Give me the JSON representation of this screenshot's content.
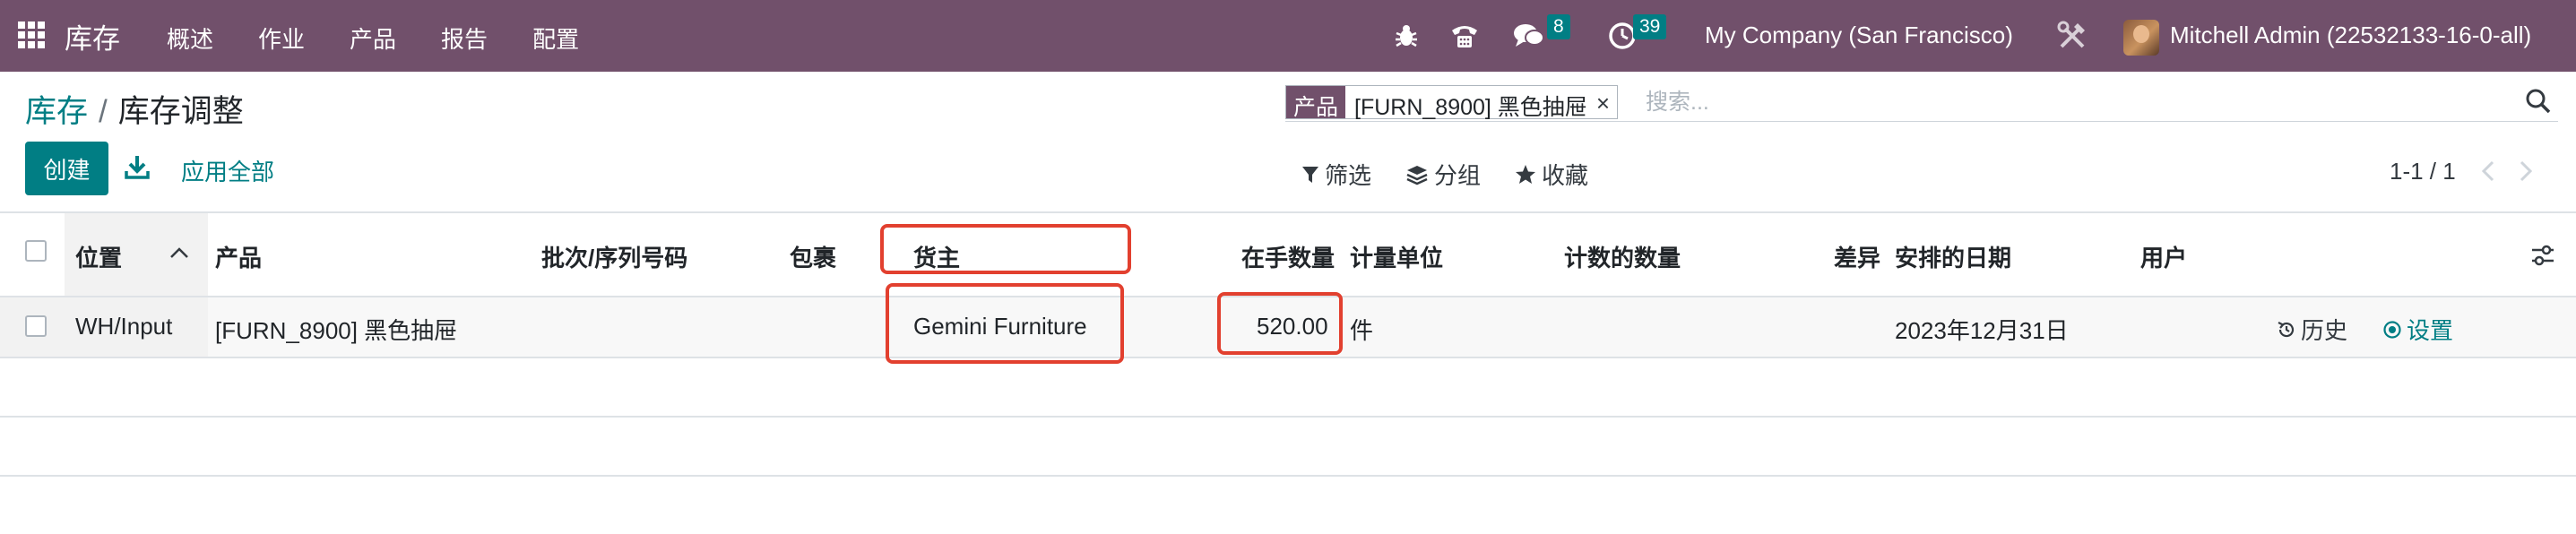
{
  "navbar": {
    "app_name": "库存",
    "menu": [
      "概述",
      "作业",
      "产品",
      "报告",
      "配置"
    ],
    "messages_count": "8",
    "activities_count": "39",
    "company": "My Company (San Francisco)",
    "user": "Mitchell Admin (22532133-16-0-all)"
  },
  "breadcrumb": {
    "parent": "库存",
    "separator": "/",
    "current": "库存调整"
  },
  "search": {
    "facet_label": "产品",
    "facet_value": "[FURN_8900] 黑色抽屉",
    "facet_close": "×",
    "placeholder": "搜索..."
  },
  "actions": {
    "create": "创建",
    "apply_all": "应用全部"
  },
  "search_options": {
    "filters": "筛选",
    "group_by": "分组",
    "favorites": "收藏"
  },
  "pager": {
    "range": "1-1 / 1"
  },
  "table": {
    "columns": {
      "location": "位置",
      "product": "产品",
      "lot": "批次/序列号码",
      "package": "包裹",
      "owner": "货主",
      "on_hand": "在手数量",
      "uom": "计量单位",
      "counted": "计数的数量",
      "difference": "差异",
      "scheduled_date": "安排的日期",
      "user": "用户"
    },
    "rows": [
      {
        "location": "WH/Input",
        "product": "[FURN_8900] 黑色抽屉",
        "owner": "Gemini Furniture",
        "on_hand": "520.00",
        "uom": "件",
        "scheduled_date": "2023年12月31日",
        "history": "历史",
        "set": "设置"
      }
    ]
  },
  "colors": {
    "navbar": "#71506b",
    "primary": "#017e84",
    "highlight": "#e2402f"
  },
  "icons": [
    "apps-grid-icon",
    "bug-icon",
    "phone-icon",
    "chat-icon",
    "clock-icon",
    "tools-icon",
    "search-icon",
    "download-icon",
    "filter-icon",
    "layers-icon",
    "star-icon",
    "chevron-left-icon",
    "chevron-right-icon",
    "sort-up-icon",
    "column-settings-icon",
    "history-icon",
    "target-icon"
  ]
}
